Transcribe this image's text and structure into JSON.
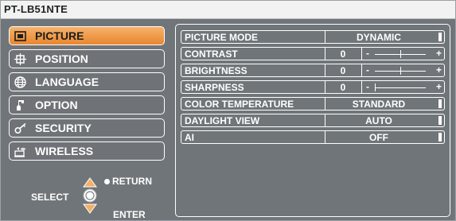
{
  "title": "PT-LB51NTE",
  "menu": {
    "items": [
      {
        "label": "PICTURE",
        "icon": "picture-icon",
        "active": true
      },
      {
        "label": "POSITION",
        "icon": "position-icon",
        "active": false
      },
      {
        "label": "LANGUAGE",
        "icon": "globe-icon",
        "active": false
      },
      {
        "label": "OPTION",
        "icon": "option-icon",
        "active": false
      },
      {
        "label": "SECURITY",
        "icon": "key-icon",
        "active": false
      },
      {
        "label": "WIRELESS",
        "icon": "wireless-icon",
        "active": false
      }
    ]
  },
  "nav": {
    "select": "SELECT",
    "return": "RETURN",
    "enter": "ENTER"
  },
  "settings": [
    {
      "name": "PICTURE MODE",
      "type": "option",
      "value": "DYNAMIC"
    },
    {
      "name": "CONTRAST",
      "type": "slider",
      "value": "0",
      "slider_position": 0.5
    },
    {
      "name": "BRIGHTNESS",
      "type": "slider",
      "value": "0",
      "slider_position": 0.5
    },
    {
      "name": "SHARPNESS",
      "type": "slider",
      "value": "0",
      "slider_position": 0.0
    },
    {
      "name": "COLOR TEMPERATURE",
      "type": "option",
      "value": "STANDARD"
    },
    {
      "name": "DAYLIGHT VIEW",
      "type": "option",
      "value": "AUTO"
    },
    {
      "name": "AI",
      "type": "option",
      "value": "OFF"
    }
  ],
  "slider_symbols": {
    "minus": "-",
    "plus": "+"
  },
  "colors": {
    "background": "#707579",
    "active": "#e8862e",
    "text": "#ffffff"
  }
}
